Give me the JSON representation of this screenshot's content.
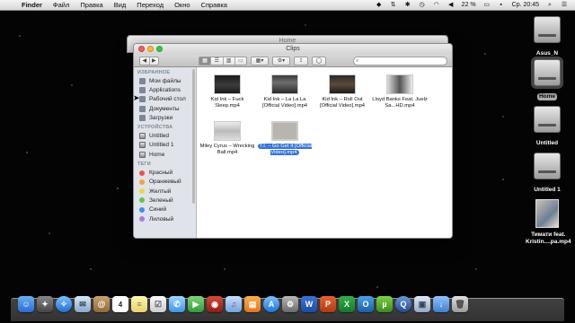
{
  "menubar": {
    "apple": "",
    "items": [
      "Finder",
      "Файл",
      "Правка",
      "Вид",
      "Переход",
      "Окно",
      "Справка"
    ],
    "battery": "22 %",
    "clock": "Ср. 20:45"
  },
  "desktop_icons": [
    {
      "label": "Asus_N"
    },
    {
      "label": "Home"
    },
    {
      "label": "Untitled"
    },
    {
      "label": "Untitled 1"
    },
    {
      "label": "Тимати feat. Kristin....ра.mp4"
    }
  ],
  "back_window": {
    "title": "Home"
  },
  "finder": {
    "title": "Clips",
    "search_placeholder": "",
    "sidebar": {
      "favorites_header": "ИЗБРАННОЕ",
      "favorites": [
        "Мои файлы",
        "Applications",
        "Рабочий стол",
        "Документы",
        "Загрузки"
      ],
      "devices_header": "УСТРОЙСТВА",
      "devices": [
        "Untitled",
        "Untitled 1",
        "Home"
      ],
      "tags_header": "ТЕГИ",
      "tags": [
        {
          "label": "Красный",
          "color": "#f0514a"
        },
        {
          "label": "Оранжевый",
          "color": "#f6a23b"
        },
        {
          "label": "Желтый",
          "color": "#f2d63a"
        },
        {
          "label": "Зеленый",
          "color": "#5fc84a"
        },
        {
          "label": "Синий",
          "color": "#3b8ef0"
        },
        {
          "label": "Лиловый",
          "color": "#b07ad8"
        }
      ]
    },
    "files": [
      {
        "name": "Kid Ink – Fuck Sleep.mp4"
      },
      {
        "name": "Kid Ink – La La La [Official Video].mp4"
      },
      {
        "name": "Kid Ink – Roll Out [Official Video].mp4"
      },
      {
        "name": "Lloyd Banks Feat. Juelz Sa...HD.mp4"
      },
      {
        "name": "Miley Cyrus – Wrecking Ball.mp4"
      },
      {
        "name": "T.I. – Go Get It [Official Video].mp4",
        "selected": true
      }
    ]
  },
  "dock": {
    "icons": [
      "finder-icon",
      "launchpad-icon",
      "safari-icon",
      "mail-icon",
      "contacts-icon",
      "calendar-icon",
      "notes-icon",
      "reminders-icon",
      "messages-icon",
      "facetime-icon",
      "photo-booth-icon",
      "itunes-icon",
      "ibooks-icon",
      "app-store-icon",
      "system-preferences-icon",
      "word-icon",
      "powerpoint-icon",
      "excel-icon",
      "outlook-icon",
      "utorrent-icon",
      "quicktime-icon",
      "preview-icon",
      "downloads-icon",
      "trash-icon"
    ],
    "calendar_day": "4"
  }
}
